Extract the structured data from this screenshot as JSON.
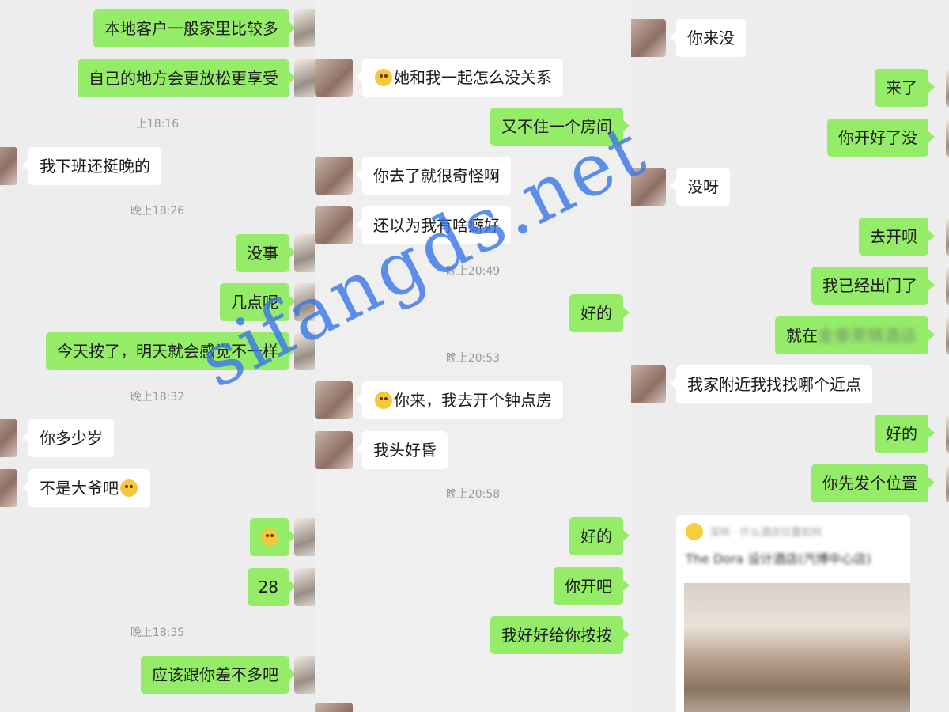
{
  "col1": {
    "m1": "本地客户一般家里比较多",
    "m2": "自己的地方会更放松更享受",
    "t1": "上18:16",
    "m3": "我下班还挺晚的",
    "t2": "晚上18:26",
    "m4": "没事",
    "m5": "几点呢",
    "m6": "今天按了，明天就会感觉不一样",
    "t3": "晚上18:32",
    "m7": "你多少岁",
    "m8": "不是大爷吧",
    "m10": "28",
    "t4": "晚上18:35",
    "m11": "应该跟你差不多吧"
  },
  "col2": {
    "m1": "她和我一起怎么没关系",
    "m2": "又不住一个房间",
    "m3": "你去了就很奇怪啊",
    "m4": "还以为我有啥癖好",
    "t1": "晚上20:49",
    "m5": "好的",
    "t2": "晚上20:53",
    "m6": "你来，我去开个钟点房",
    "m7": "我头好昏",
    "t3": "晚上20:58",
    "m8": "好的",
    "m9": "你开吧",
    "m10": "我好好给你按按"
  },
  "col3": {
    "m1": "你来没",
    "m2": "来了",
    "m3": "你开好了没",
    "m4": "没呀",
    "m5": "去开呗",
    "m6": "我已经出门了",
    "m7a": "就在",
    "m7b": "金泰荣锦酒店",
    "m8": "我家附近我找找哪个近点",
    "m9": "好的",
    "m10": "你先发个位置",
    "card_source": "深圳 · 什么酒店位置如何",
    "card_title": "The Dora 设计酒店(汽博中心店)"
  },
  "watermark": "sifangds.net",
  "colors": {
    "outgoing_bubble": "#95ec69",
    "incoming_bubble": "#ffffff",
    "background": "#ededed",
    "watermark": "#3c78e6"
  }
}
